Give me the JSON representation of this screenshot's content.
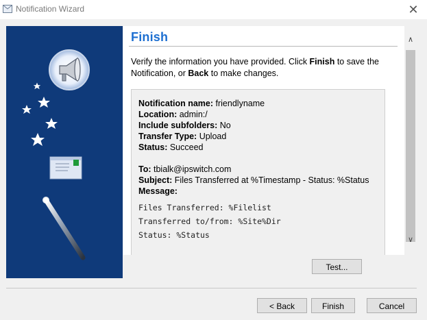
{
  "window": {
    "title": "Notification Wizard",
    "close_glyph": "✕"
  },
  "page": {
    "title": "Finish",
    "intro_1": "Verify the information you have provided. Click ",
    "intro_finish": "Finish",
    "intro_2": " to save the Notification, or ",
    "intro_back": "Back",
    "intro_3": " to make changes."
  },
  "summary": {
    "name_label": "Notification name:",
    "name_value": " friendlyname",
    "location_label": "Location:",
    "location_value": " admin:/",
    "subfolders_label": "Include subfolders:",
    "subfolders_value": " No",
    "transfer_label": "Transfer Type:",
    "transfer_value": " Upload",
    "status_label": "Status:",
    "status_value": " Succeed",
    "to_label": "To:",
    "to_value": " tbialk@ipswitch.com",
    "subject_label": "Subject:",
    "subject_value": " Files Transferred at %Timestamp - Status: %Status",
    "message_label": "Message:",
    "message_lines": [
      "Files Transferred: %Filelist",
      "Transferred to/from: %Site%Dir",
      "Status: %Status"
    ]
  },
  "buttons": {
    "test": "Test...",
    "back": "< Back",
    "finish": "Finish",
    "cancel": "Cancel"
  },
  "icons": {
    "app": "window-icon",
    "megaphone": "megaphone-icon",
    "envelope": "envelope-icon",
    "wand": "magic-wand-icon"
  },
  "colors": {
    "title_accent": "#1d6fd1",
    "sidepanel": "#0f3a7a"
  }
}
